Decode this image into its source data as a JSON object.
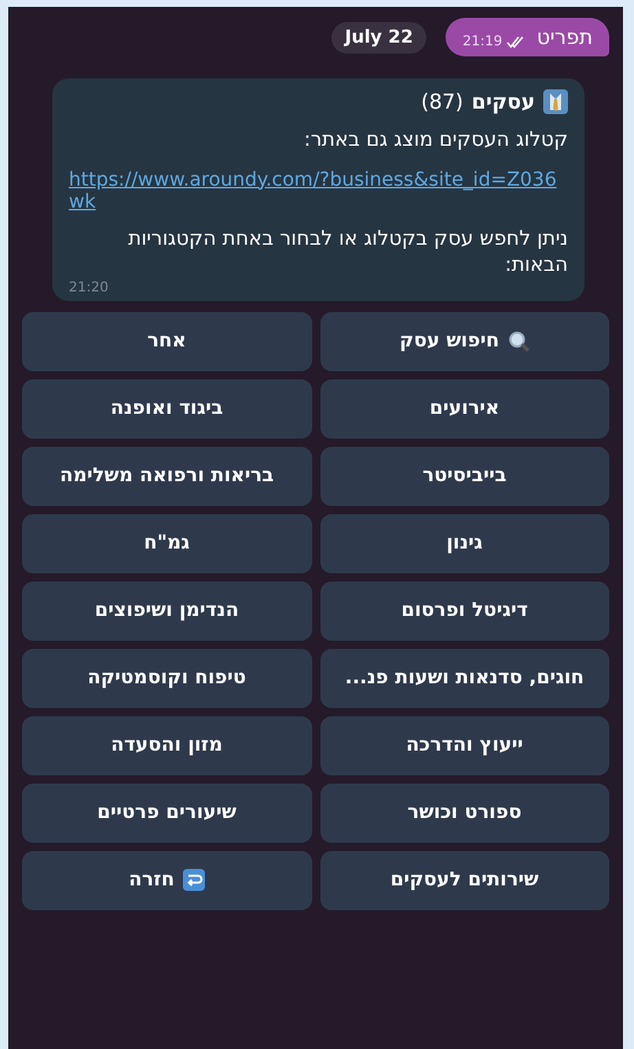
{
  "date_chip": "July 22",
  "sent_message": {
    "text": "תפריט",
    "time": "21:19",
    "read": true
  },
  "incoming_message": {
    "title": "עסקים",
    "count": "(87)",
    "intro": "קטלוג העסקים מוצג גם באתר:",
    "link": "https://www.aroundy.com/?business&site_id=Z036wk",
    "prompt": "ניתן לחפש עסק בקטלוג או לבחור באחת הקטגוריות הבאות:",
    "time": "21:20"
  },
  "keyboard_buttons": [
    {
      "label": "חיפוש עסק",
      "kind": "search"
    },
    {
      "label": "אחר",
      "kind": "plain"
    },
    {
      "label": "אירועים",
      "kind": "plain"
    },
    {
      "label": "ביגוד ואופנה",
      "kind": "plain"
    },
    {
      "label": "בייביסיטר",
      "kind": "plain"
    },
    {
      "label": "בריאות ורפואה משלימה",
      "kind": "plain"
    },
    {
      "label": "גינון",
      "kind": "plain"
    },
    {
      "label": "גמ\"ח",
      "kind": "plain"
    },
    {
      "label": "דיגיטל ופרסום",
      "kind": "plain"
    },
    {
      "label": "הנדימן ושיפוצים",
      "kind": "plain"
    },
    {
      "label": "חוגים, סדנאות ושעות פנ...",
      "kind": "plain"
    },
    {
      "label": "טיפוח וקוסמטיקה",
      "kind": "plain"
    },
    {
      "label": "ייעוץ והדרכה",
      "kind": "plain"
    },
    {
      "label": "מזון והסעדה",
      "kind": "plain"
    },
    {
      "label": "ספורט וכושר",
      "kind": "plain"
    },
    {
      "label": "שיעורים פרטיים",
      "kind": "plain"
    },
    {
      "label": "שירותים לעסקים",
      "kind": "plain"
    },
    {
      "label": "חזרה",
      "kind": "back"
    }
  ]
}
